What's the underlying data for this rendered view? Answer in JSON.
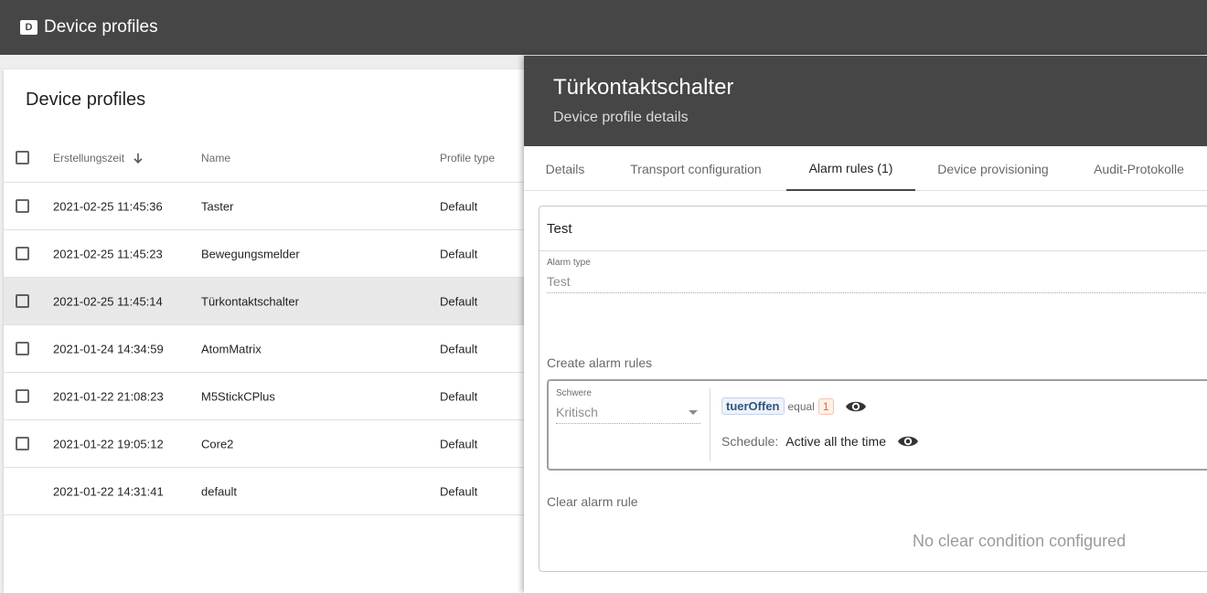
{
  "app": {
    "logo_letter": "D",
    "title": "Device profiles"
  },
  "list": {
    "title": "Device profiles",
    "columns": {
      "created": "Erstellungszeit",
      "name": "Name",
      "type": "Profile type"
    },
    "rows": [
      {
        "created": "2021-02-25 11:45:36",
        "name": "Taster",
        "type": "Default",
        "has_checkbox": true,
        "selected": false
      },
      {
        "created": "2021-02-25 11:45:23",
        "name": "Bewegungsmelder",
        "type": "Default",
        "has_checkbox": true,
        "selected": false
      },
      {
        "created": "2021-02-25 11:45:14",
        "name": "Türkontaktschalter",
        "type": "Default",
        "has_checkbox": true,
        "selected": true
      },
      {
        "created": "2021-01-24 14:34:59",
        "name": "AtomMatrix",
        "type": "Default",
        "has_checkbox": true,
        "selected": false
      },
      {
        "created": "2021-01-22 21:08:23",
        "name": "M5StickCPlus",
        "type": "Default",
        "has_checkbox": true,
        "selected": false
      },
      {
        "created": "2021-01-22 19:05:12",
        "name": "Core2",
        "type": "Default",
        "has_checkbox": true,
        "selected": false
      },
      {
        "created": "2021-01-22 14:31:41",
        "name": "default",
        "type": "Default",
        "has_checkbox": false,
        "selected": false
      }
    ]
  },
  "panel": {
    "title": "Türkontaktschalter",
    "subtitle": "Device profile details",
    "tabs": [
      {
        "label": "Details",
        "active": false
      },
      {
        "label": "Transport configuration",
        "active": false
      },
      {
        "label": "Alarm rules (1)",
        "active": true
      },
      {
        "label": "Device provisioning",
        "active": false
      },
      {
        "label": "Audit-Protokolle",
        "active": false
      }
    ],
    "alarm": {
      "name": "Test",
      "type_label": "Alarm type",
      "type_value": "Test",
      "create_rules_label": "Create alarm rules",
      "rule": {
        "severity_label": "Schwere",
        "severity_value": "Kritisch",
        "condition_key": "tuerOffen",
        "condition_op": "equal",
        "condition_value": "1",
        "schedule_label": "Schedule:",
        "schedule_value": "Active all the time"
      },
      "clear_rule_label": "Clear alarm rule",
      "no_clear_text": "No clear condition configured"
    }
  },
  "colors": {
    "header_bg": "#464646",
    "selected_row": "#e8e8e8",
    "key_chip": "#305680",
    "value_chip": "#e06a2e"
  }
}
